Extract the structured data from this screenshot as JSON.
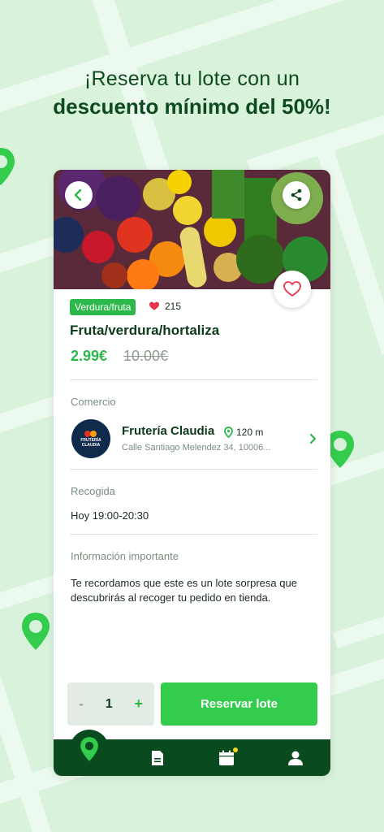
{
  "headline": {
    "line1": "¡Reserva tu lote con un",
    "line2": "descuento mínimo del 50%!"
  },
  "product": {
    "category": "Verdura/fruta",
    "likes": "215",
    "title": "Fruta/verdura/hortaliza",
    "price": "2.99€",
    "old_price": "10.00€"
  },
  "shop": {
    "section_label": "Comercio",
    "logo_text": "FRUTERÍA CLAUDIA",
    "name": "Frutería Claudia",
    "distance": "120 m",
    "address": "Calle Santiago Melendez 34, 10006..."
  },
  "pickup": {
    "section_label": "Recogida",
    "time": "Hoy 19:00-20:30"
  },
  "info": {
    "section_label": "Información importante",
    "text": "Te recordamos que este es un lote sorpresa que descubrirás al recoger tu pedido en tienda."
  },
  "actions": {
    "qty_minus": "-",
    "qty_value": "1",
    "qty_plus": "+",
    "reserve_label": "Reservar lote"
  },
  "colors": {
    "brand_green": "#33cc4c",
    "dark_green": "#0a4a1f",
    "background": "#d9f2dc"
  },
  "icons": {
    "back": "chevron-left-icon",
    "share": "share-icon",
    "favorite": "heart-outline-icon",
    "likes": "heart-filled-icon",
    "location": "location-pin-icon",
    "tabs": [
      "map-pin-icon",
      "document-icon",
      "calendar-icon",
      "user-icon"
    ]
  }
}
